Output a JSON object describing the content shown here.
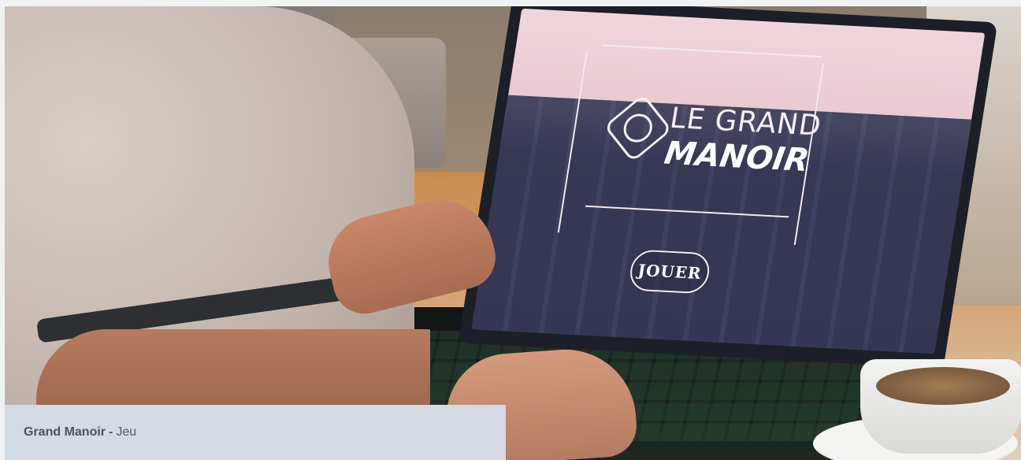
{
  "screen": {
    "title_line1": "LE GRAND",
    "title_line2": "MANOIR",
    "play_label": "JOUER"
  },
  "caption": {
    "title": "Grand Manoir",
    "separator": "-",
    "category": "Jeu"
  },
  "colors": {
    "caption_bg": "#d4dbe2",
    "caption_text": "#4f5b66",
    "screen_pink": "#f1d5dc",
    "manor_navy": "#353754"
  }
}
